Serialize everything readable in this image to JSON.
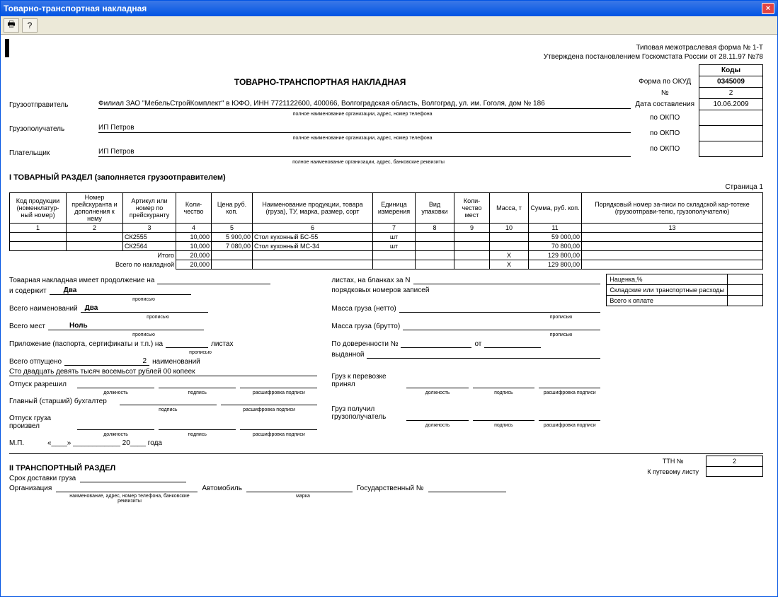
{
  "window": {
    "title": "Товарно-транспортная накладная",
    "close": "×"
  },
  "header": {
    "form_line": "Типовая межотраслевая форма № 1-Т",
    "approved": "Утверждена постановлением Госкомстата России от 28.11.97 №78",
    "codes_hdr": "Коды",
    "okud_lbl": "Форма по ОКУД",
    "okud": "0345009",
    "num_lbl": "№",
    "num": "2",
    "date_lbl": "Дата составления",
    "date": "10.06.2009"
  },
  "title": "ТОВАРНО-ТРАНСПОРТНАЯ НАКЛАДНАЯ",
  "sender": {
    "lbl": "Грузоотправитель",
    "val": "Филиал ЗАО \"МебельСтройКомплект\" в ЮФО, ИНН 7721122600, 400066, Волгоградская область, Волгоград, ул. им. Гоголя, дом № 186",
    "sub": "полное наименование организации, адрес, номер телефона",
    "okpo_lbl": "по ОКПО",
    "okpo": ""
  },
  "receiver": {
    "lbl": "Грузополучатель",
    "val": "ИП Петров",
    "sub": "полное наименование организации, адрес, номер телефона",
    "okpo_lbl": "по ОКПО",
    "okpo": ""
  },
  "payer": {
    "lbl": "Плательщик",
    "val": "ИП Петров",
    "sub": "полное наименование организации, адрес, банковские реквизиты",
    "okpo_lbl": "по ОКПО",
    "okpo": ""
  },
  "section1": {
    "title": "I ТОВАРНЫЙ РАЗДЕЛ (заполняется грузоотправителем)",
    "page": "Страница 1"
  },
  "table": {
    "h1": "Код продукции (номенклатур-ный номер)",
    "h2": "Номер прейскуранта и дополнения к нему",
    "h3": "Артикул или номер по прейскуранту",
    "h4": "Коли-чество",
    "h5": "Цена руб. коп.",
    "h6": "Наименование продукции, товара (груза), ТУ, марка, размер, сорт",
    "h7": "Единица измерения",
    "h8": "Вид упаковки",
    "h9": "Коли-чество мест",
    "h10": "Масса, т",
    "h11": "Сумма, руб. коп.",
    "h13": "Порядковый номер за-писи по складской кар-тотеке (грузоотправи-телю, грузополучателю)",
    "n1": "1",
    "n2": "2",
    "n3": "3",
    "n4": "4",
    "n5": "5",
    "n6": "6",
    "n7": "7",
    "n8": "8",
    "n9": "9",
    "n10": "10",
    "n11": "11",
    "n13": "13",
    "rows": [
      {
        "art": "СК2555",
        "qty": "10,000",
        "price": "5 900,00",
        "name": "Стол кухонный БС-55",
        "unit": "шт",
        "pack": "",
        "places": "",
        "mass": "",
        "sum": "59 000,00",
        "ord": ""
      },
      {
        "art": "СК2564",
        "qty": "10,000",
        "price": "7 080,00",
        "name": "Стол кухонный МС-34",
        "unit": "шт",
        "pack": "",
        "places": "",
        "mass": "",
        "sum": "70 800,00",
        "ord": ""
      }
    ],
    "itogo_lbl": "Итого",
    "itogo_qty": "20,000",
    "itogo_mass": "Х",
    "itogo_sum": "129 800,00",
    "total_lbl": "Всего по накладной",
    "total_qty": "20,000",
    "total_mass": "Х",
    "total_sum": "129 800,00"
  },
  "footer": {
    "cont_lbl": "Товарная накладная имеет продолжение на",
    "sheets_lbl": "листах, на бланках за N",
    "contains_lbl": "и содержит",
    "contains_val": "Два",
    "records_lbl": "порядковых номеров записей",
    "names_lbl": "Всего наименований",
    "names_val": "Два",
    "mass_net_lbl": "Масса груза (нетто)",
    "places_lbl": "Всего мест",
    "places_val": "Ноль",
    "mass_gross_lbl": "Масса груза (брутто)",
    "app_lbl": "Приложение (паспорта, сертификаты и т.п.) на",
    "app_sheets": "листах",
    "proxy_lbl": "По доверенности №",
    "proxy_from": "от",
    "released_lbl": "Всего отпущено",
    "released_val": "2",
    "released_unit": "наименований",
    "issued_lbl": "выданной",
    "sum_words": "Сто двадцать девять тысяч восемьсот рублей 00 копеек",
    "release_allowed": "Отпуск разрешил",
    "accountant": "Главный (старший) бухгалтер",
    "release_made": "Отпуск груза произвел",
    "mp": "М.П.",
    "date_quote": "«____» ____________ 20____ года",
    "cargo_accepted": "Груз к перевозке принял",
    "cargo_received": "Груз получил грузополучатель",
    "position": "должность",
    "signature": "подпись",
    "decode": "расшифровка подписи",
    "prop": "прописью"
  },
  "side": {
    "markup": "Наценка,%",
    "storage": "Складские или транспортные расходы",
    "total": "Всего к оплате"
  },
  "section2": {
    "title": "II ТРАНСПОРТНЫЙ РАЗДЕЛ",
    "delivery": "Срок доставки груза",
    "org": "Организация",
    "org_sub": "наименование, адрес, номер телефона, банковские реквизиты",
    "auto": "Автомобиль",
    "auto_sub": "марка",
    "state_num": "Государственный №",
    "ttn_lbl": "ТТН №",
    "ttn_val": "2",
    "route_lbl": "К путевому листу"
  }
}
